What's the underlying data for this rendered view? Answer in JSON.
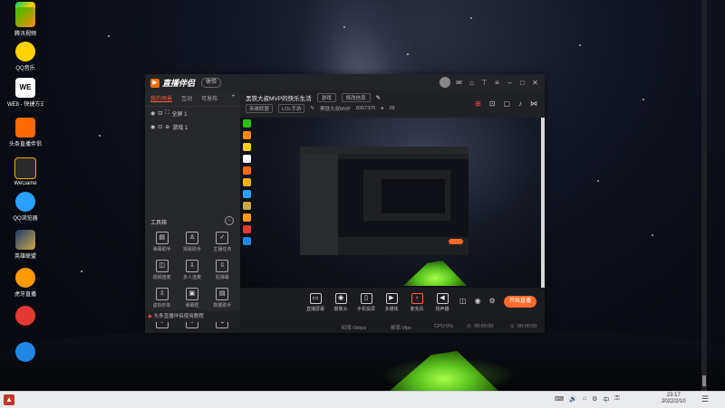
{
  "desktop": {
    "icons": [
      {
        "label": "",
        "icon": "google-play-like-icon",
        "color": "#2dc100"
      },
      {
        "label": "腾讯视频",
        "icon": "tencent-video-icon",
        "color": "#ff8a00"
      },
      {
        "label": "QQ音乐",
        "icon": "qq-music-icon",
        "color": "#ffd200"
      },
      {
        "label": "WE8 - 快捷方式",
        "icon": "we8-icon",
        "color": "#ffffff"
      },
      {
        "label": "头条直播伴侣",
        "icon": "toutiao-live-icon",
        "color": "#ff6a00"
      },
      {
        "label": "WeGame",
        "icon": "wegame-icon",
        "color": "#f0b000"
      },
      {
        "label": "QQ浏览器",
        "icon": "qq-browser-icon",
        "color": "#2aa0ff"
      },
      {
        "label": "英雄联盟",
        "icon": "lol-icon",
        "color": "#c8a84a"
      },
      {
        "label": "虎牙直播",
        "icon": "huya-icon",
        "color": "#ff9a00"
      },
      {
        "label": "",
        "icon": "red-app-icon",
        "color": "#e53935"
      },
      {
        "label": "",
        "icon": "blue-app-icon",
        "color": "#1e88e5"
      }
    ]
  },
  "app": {
    "logo_text": "直播伴侣",
    "version_pill": "体验",
    "sidebar": {
      "tabs": [
        "我的场景",
        "互动",
        "可发布"
      ],
      "add_tab": "+",
      "scenes": [
        {
          "label": "全屏 1"
        },
        {
          "label": "游戏 1"
        }
      ],
      "tools_title": "工具箱",
      "tools_toggle": "−",
      "tools": [
        {
          "label": "弹幕助手",
          "glyph": "▤"
        },
        {
          "label": "观看助手",
          "glyph": "♙"
        },
        {
          "label": "主播任务",
          "glyph": "✓"
        },
        {
          "label": "视频连麦",
          "glyph": "◫"
        },
        {
          "label": "多人连麦",
          "glyph": "⇩"
        },
        {
          "label": "贴弹幕",
          "glyph": "⇩"
        },
        {
          "label": "虚拟形象",
          "glyph": "⇩"
        },
        {
          "label": "弹幕框",
          "glyph": "▣"
        },
        {
          "label": "数据助手",
          "glyph": "▤"
        },
        {
          "label": "",
          "glyph": "⇩"
        },
        {
          "label": "",
          "glyph": "⇩"
        },
        {
          "label": "",
          "glyph": "⚙"
        }
      ],
      "footer": "头条直播伴侣使用教程"
    },
    "header": {
      "stream_title": "黑铁大叔MVP的快乐生活",
      "chip_game": "游戏",
      "chip_edit": "修改信息",
      "category": "英雄联盟",
      "sub_category": "LOL手游",
      "host": "黑铁大叔MVP",
      "room_id": "8357375",
      "fans": "28"
    },
    "controls": [
      {
        "label": "直播屏幕",
        "glyph": "▭"
      },
      {
        "label": "摄像头",
        "glyph": "◉"
      },
      {
        "label": "手机投屏",
        "glyph": "▯"
      },
      {
        "label": "多媒体",
        "glyph": "▶"
      },
      {
        "label": "麦克风",
        "glyph": "◖"
      },
      {
        "label": "扬声器",
        "glyph": "◀"
      }
    ],
    "live_button": "开始直播",
    "status": {
      "bitrate": "码率:0kbps",
      "fps": "帧率:0fps",
      "cpu": "CPU:0%",
      "time1": "00:00:00",
      "time2": "00:00:00"
    }
  },
  "taskbar": {
    "time": "23:17",
    "date": "2022/2/10",
    "tray": [
      "⌨",
      "🔊",
      "⌂",
      "⚙",
      "中",
      "⚿"
    ],
    "start_glyph": "▲",
    "notif_glyph": "☰"
  }
}
